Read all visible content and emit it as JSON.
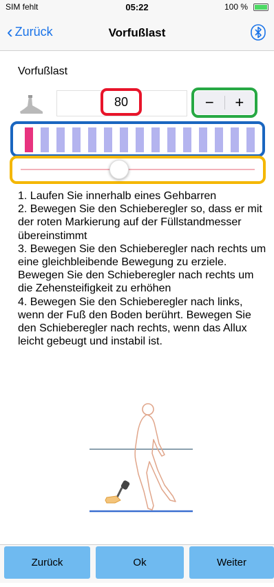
{
  "status": {
    "carrier": "SIM fehlt",
    "time": "05:22",
    "battery": "100 %",
    "battery_fill": 1.0
  },
  "nav": {
    "back_label": "Zurück",
    "title": "Vorfußlast",
    "bluetooth_icon": "bluetooth-icon"
  },
  "section": {
    "label": "Vorfußlast",
    "foot_icon": "prosthetic-foot-icon"
  },
  "value": {
    "current": "80"
  },
  "stepper": {
    "minus": "−",
    "plus": "+"
  },
  "gauge": {
    "segment_count": 15,
    "marker_index": 0,
    "marker_color": "#e8337f",
    "segment_color": "#b4b4ef"
  },
  "slider": {
    "value": 0.42,
    "track_color": "#f3b2ba"
  },
  "instructions": [
    "1. Laufen Sie innerhalb eines Gehbarren",
    "2. Bewegen Sie den Schieberegler so, dass er mit der roten Markierung auf der Füllstandmesser übereinstimmt",
    "3. Bewegen Sie den Schieberegler nach rechts  um eine gleichbleibende Bewegung zu erziele.",
    "Bewegen Sie den Schieberegler nach rechts um die Zehensteifigkeit zu erhöhen",
    "4. Bewegen Sie den Schieberegler nach links, wenn der Fuß den Boden berührt. Bewegen Sie den Schieberegler nach rechts, wenn das Allux leicht gebeugt und instabil ist."
  ],
  "illustration": {
    "icon": "walking-prosthesis-illustration"
  },
  "bottom_buttons": {
    "back": "Zurück",
    "ok": "Ok",
    "next": "Weiter"
  },
  "colors": {
    "accent": "#1a73e8",
    "button": "#6fbaf0",
    "highlight_red": "#e8142a",
    "highlight_green": "#27a844",
    "highlight_blue": "#1a66c0",
    "highlight_yellow": "#f4b700"
  }
}
